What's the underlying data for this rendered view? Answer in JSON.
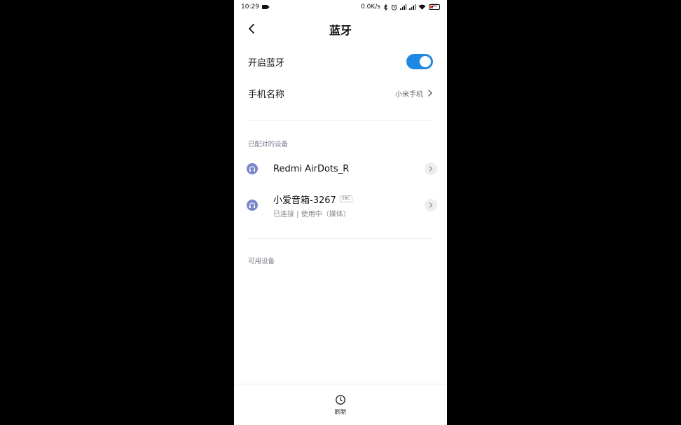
{
  "status_bar": {
    "time": "10:29",
    "speed": "0.0K/s",
    "battery": "20",
    "icons": [
      "video-camera-icon",
      "bluetooth-icon",
      "alarm-icon",
      "signal-icon",
      "signal-icon",
      "wifi-icon",
      "battery-icon"
    ]
  },
  "header": {
    "title": "蓝牙",
    "back_icon": "back-chevron-icon"
  },
  "settings": {
    "bluetooth_toggle": {
      "label": "开启蓝牙",
      "state": "on",
      "color": "#1e88e5"
    },
    "device_name": {
      "label": "手机名称",
      "value": "小米手机"
    }
  },
  "paired": {
    "section_title": "已配对的设备",
    "devices": [
      {
        "name": "Redmi AirDots_R",
        "icon": "headphones-icon"
      },
      {
        "name": "小爱音箱-3267",
        "badge": "SBC",
        "status": "已连接 | 使用中（媒体）",
        "icon": "headphones-icon"
      }
    ]
  },
  "available": {
    "section_title": "可用设备"
  },
  "bottom": {
    "refresh_label": "刷新",
    "refresh_icon": "refresh-clock-icon"
  }
}
